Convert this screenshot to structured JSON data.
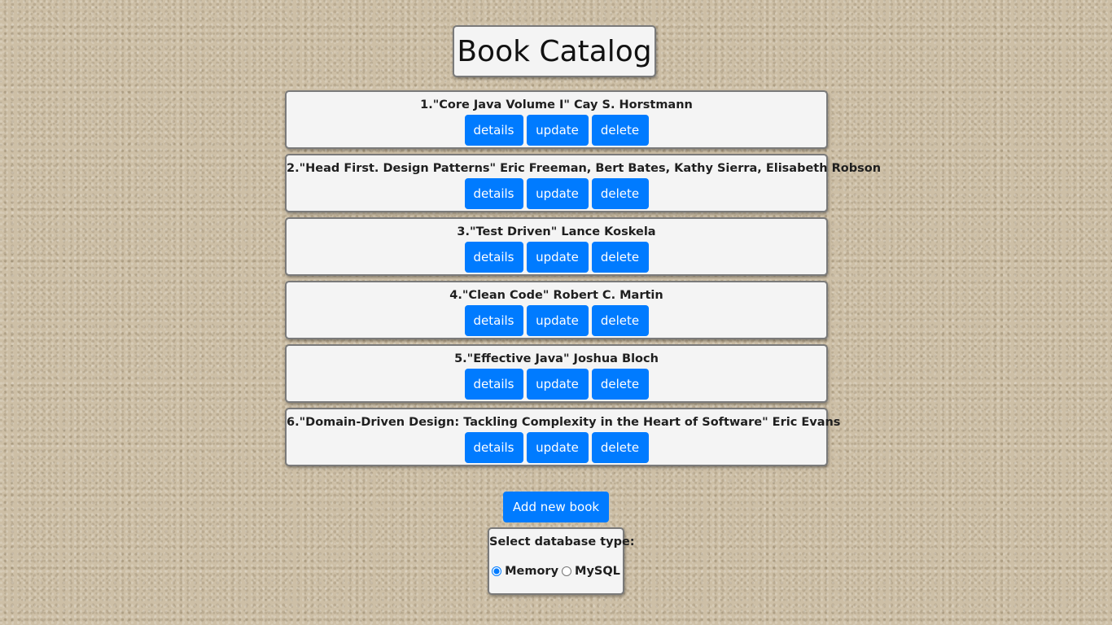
{
  "header": {
    "title": "Book Catalog"
  },
  "books": [
    {
      "label": "1.\"Core Java Volume I\" Cay S. Horstmann"
    },
    {
      "label": "2.\"Head First. Design Patterns\" Eric Freeman, Bert Bates, Kathy Sierra, Elisabeth Robson"
    },
    {
      "label": "3.\"Test Driven\" Lance Koskela"
    },
    {
      "label": "4.\"Clean Code\" Robert C. Martin"
    },
    {
      "label": "5.\"Effective Java\" Joshua Bloch"
    },
    {
      "label": "6.\"Domain-Driven Design: Tackling Complexity in the Heart of Software\" Eric Evans"
    }
  ],
  "actions": {
    "details_label": "details",
    "update_label": "update",
    "delete_label": "delete",
    "add_label": "Add new book"
  },
  "database": {
    "prompt": "Select database type:",
    "options": [
      {
        "label": "Memory",
        "selected": true
      },
      {
        "label": "MySQL",
        "selected": false
      }
    ]
  },
  "colors": {
    "accent": "#007bff",
    "card_background": "#f4f4f4",
    "page_background": "#cdbfa6"
  }
}
